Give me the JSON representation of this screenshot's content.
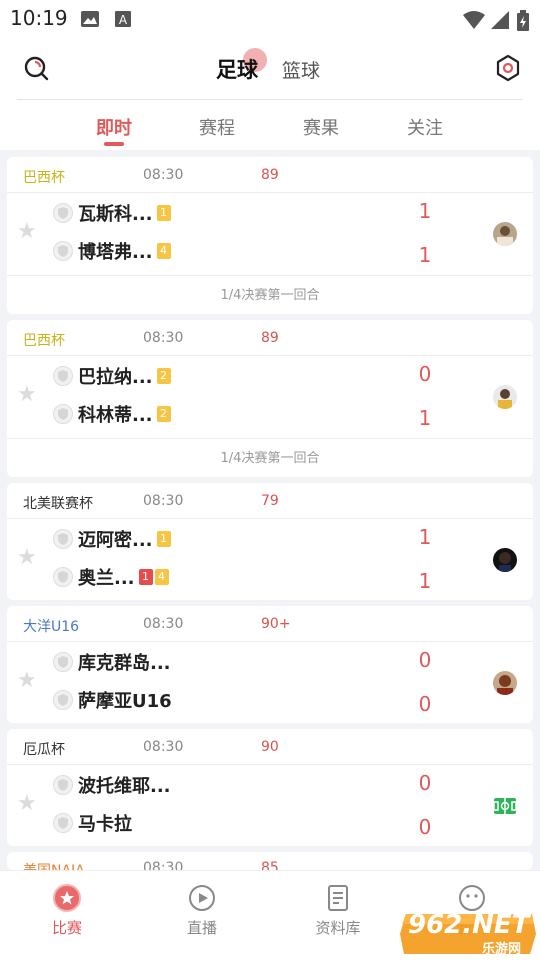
{
  "status_bar": {
    "time": "10:19"
  },
  "header": {
    "sport_tabs": [
      {
        "label": "足球",
        "active": true
      },
      {
        "label": "篮球",
        "active": false
      }
    ],
    "sub_tabs": [
      {
        "label": "即时",
        "active": true
      },
      {
        "label": "赛程",
        "active": false
      },
      {
        "label": "赛果",
        "active": false
      },
      {
        "label": "关注",
        "active": false
      }
    ]
  },
  "matches": [
    {
      "league": "巴西杯",
      "league_color": "#c9b317",
      "time": "08:30",
      "minute": "89",
      "home": {
        "name": "瓦斯科...",
        "badges": [
          {
            "text": "1",
            "color": "yellow"
          }
        ],
        "score": "1"
      },
      "away": {
        "name": "博塔弗...",
        "badges": [
          {
            "text": "4",
            "color": "yellow"
          }
        ],
        "score": "1"
      },
      "footer": "1/4决赛第一回合",
      "avatar": "player-avatar"
    },
    {
      "league": "巴西杯",
      "league_color": "#c9b317",
      "time": "08:30",
      "minute": "89",
      "home": {
        "name": "巴拉纳...",
        "badges": [
          {
            "text": "2",
            "color": "yellow"
          }
        ],
        "score": "0"
      },
      "away": {
        "name": "科林蒂...",
        "badges": [
          {
            "text": "2",
            "color": "yellow"
          }
        ],
        "score": "1"
      },
      "footer": "1/4决赛第一回合",
      "avatar": "player-avatar"
    },
    {
      "league": "北美联赛杯",
      "league_color": "#333333",
      "time": "08:30",
      "minute": "79",
      "home": {
        "name": "迈阿密...",
        "badges": [
          {
            "text": "1",
            "color": "yellow"
          }
        ],
        "score": "1"
      },
      "away": {
        "name": "奥兰...",
        "badges": [
          {
            "text": "1",
            "color": "red"
          },
          {
            "text": "4",
            "color": "yellow"
          }
        ],
        "score": "1"
      },
      "footer": "",
      "avatar": "player-avatar"
    },
    {
      "league": "大洋U16",
      "league_color": "#4a78c2",
      "time": "08:30",
      "minute": "90+",
      "home": {
        "name": "库克群岛...",
        "badges": [],
        "score": "0"
      },
      "away": {
        "name": "萨摩亚U16",
        "badges": [],
        "score": "0"
      },
      "footer": "",
      "avatar": "player-avatar"
    },
    {
      "league": "厄瓜杯",
      "league_color": "#333333",
      "time": "08:30",
      "minute": "90",
      "home": {
        "name": "波托维耶...",
        "badges": [],
        "score": "0"
      },
      "away": {
        "name": "马卡拉",
        "badges": [],
        "score": "0"
      },
      "footer": "",
      "avatar": "field-icon"
    },
    {
      "league": "美国NAIA",
      "league_color": "#e0843a",
      "time": "08:30",
      "minute": "85"
    }
  ],
  "bottom_nav": [
    {
      "label": "比赛",
      "icon": "match-icon",
      "active": true
    },
    {
      "label": "直播",
      "icon": "live-play-icon",
      "active": false
    },
    {
      "label": "资料库",
      "icon": "database-icon",
      "active": false
    },
    {
      "label": "我的",
      "icon": "profile-icon",
      "active": false
    }
  ],
  "watermark": {
    "logo": "962.NET",
    "site": "乐游网"
  },
  "colors": {
    "accent": "#e05a5a",
    "badge_yellow": "#f6c543",
    "badge_red": "#e64c4c"
  }
}
